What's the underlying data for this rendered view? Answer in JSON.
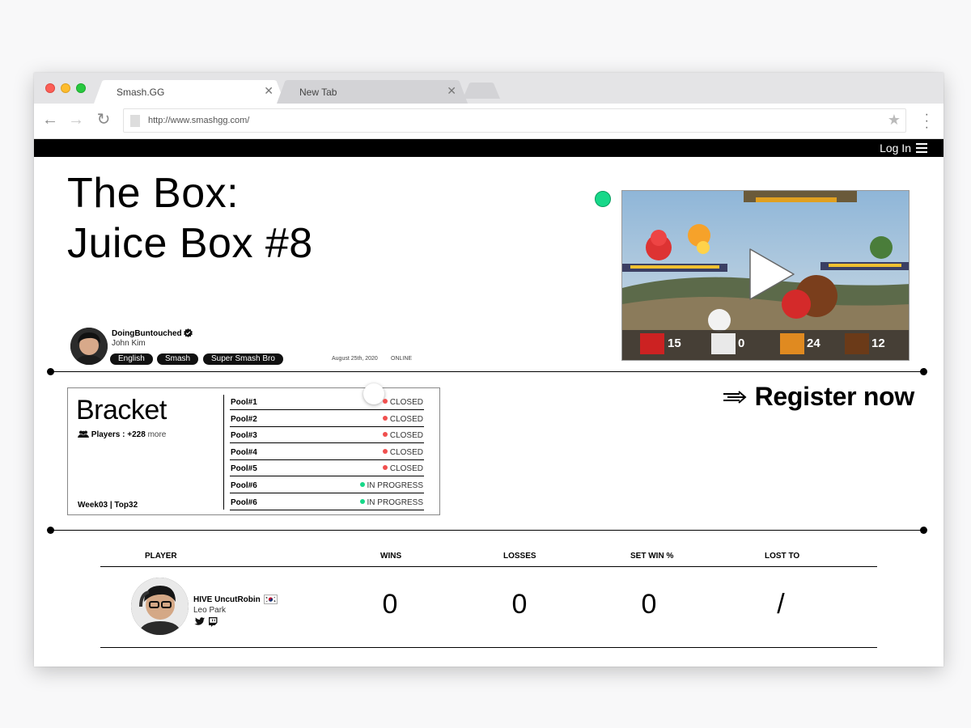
{
  "browser": {
    "tabs": [
      {
        "label": "Smash.GG",
        "close": "✕"
      },
      {
        "label": "New Tab",
        "close": "✕"
      }
    ],
    "url": "http://www.smashgg.com/"
  },
  "header": {
    "login_label": "Log In"
  },
  "event": {
    "title_line1": "The Box:",
    "title_line2": "Juice Box #8",
    "organizer": {
      "handle": "DoingBuntouched",
      "name": "John Kim"
    },
    "tags": [
      "English",
      "Smash",
      "Super Smash Bro"
    ],
    "date": "August 25th, 2020",
    "mode": "ONLINE"
  },
  "bracket": {
    "title": "Bracket",
    "players_label": "Players :",
    "players_count": "+228",
    "players_more": "more",
    "footer": "Week03 | Top32",
    "pools": [
      {
        "name": "Pool#1",
        "status": "CLOSED",
        "color": "#f0504f"
      },
      {
        "name": "Pool#2",
        "status": "CLOSED",
        "color": "#f0504f"
      },
      {
        "name": "Pool#3",
        "status": "CLOSED",
        "color": "#f0504f"
      },
      {
        "name": "Pool#4",
        "status": "CLOSED",
        "color": "#f0504f"
      },
      {
        "name": "Pool#5",
        "status": "CLOSED",
        "color": "#f0504f"
      },
      {
        "name": "Pool#6",
        "status": "IN PROGRESS",
        "color": "#17d889"
      },
      {
        "name": "Pool#6",
        "status": "IN PROGRESS",
        "color": "#17d889"
      }
    ]
  },
  "register": {
    "arrow": "⇾",
    "label": "Register now"
  },
  "standings": {
    "columns": [
      "PLAYER",
      "WINS",
      "LOSSES",
      "SET WIN %",
      "LOST TO"
    ],
    "rows": [
      {
        "handle": "HIVE UncutRobin",
        "name": "Leo Park",
        "wins": "0",
        "losses": "0",
        "set_win": "0",
        "lost_to": "/"
      }
    ]
  },
  "colors": {
    "accent_green": "#17d889",
    "closed_red": "#f0504f"
  }
}
